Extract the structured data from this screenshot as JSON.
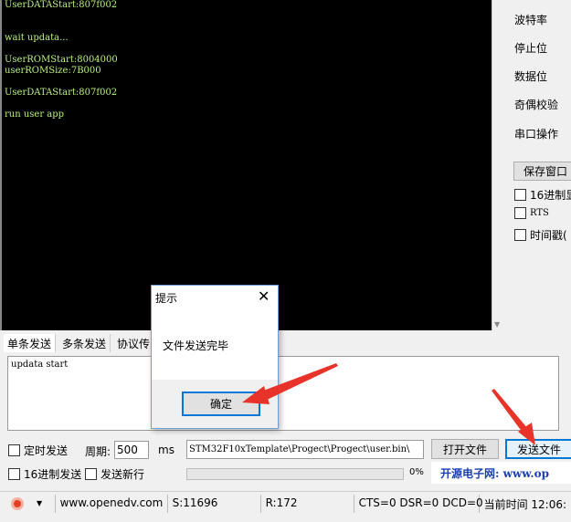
{
  "terminal": {
    "lines": [
      "UserDATAStart:807f002",
      "",
      "",
      "wait updata...",
      "",
      "UserROMStart:8004000",
      "userROMSize:7B000",
      "",
      "UserDATAStart:807f002",
      "",
      "run user app"
    ]
  },
  "settings": {
    "baud": "波特率",
    "stop": "停止位",
    "data": "数据位",
    "parity": "奇偶校验",
    "port_op": "串口操作",
    "save_window": "保存窗口",
    "hex_display": "16进制显",
    "rts": "RTS",
    "timestamp": "时间戳("
  },
  "tabs": [
    "单条发送",
    "多条发送",
    "协议传"
  ],
  "send_text": "updata start",
  "options": {
    "timed_send": "定时发送",
    "period_label": "周期:",
    "period_value": "500",
    "ms": "ms",
    "hex_send": "16进制发送",
    "send_newline": "发送新行"
  },
  "file_path": "\\STM32F10xTemplate\\Progect\\Progect\\user.bin",
  "open_file": "打开文件",
  "send_file": "发送文件",
  "progress": {
    "percent_label": "0%",
    "value": 0
  },
  "banner": "开源电子网: www.op",
  "status": {
    "site": "www.openedv.com",
    "sent": "S:11696",
    "received": "R:172",
    "lines": "CTS=0 DSR=0 DCD=0",
    "time": "当前时间 12:06:"
  },
  "dialog": {
    "title": "提示",
    "message": "文件发送完毕",
    "ok": "确定"
  },
  "colors": {
    "terminal_text": "#b8f07a",
    "arrow": "#e8332a",
    "focus": "#0078d7"
  }
}
